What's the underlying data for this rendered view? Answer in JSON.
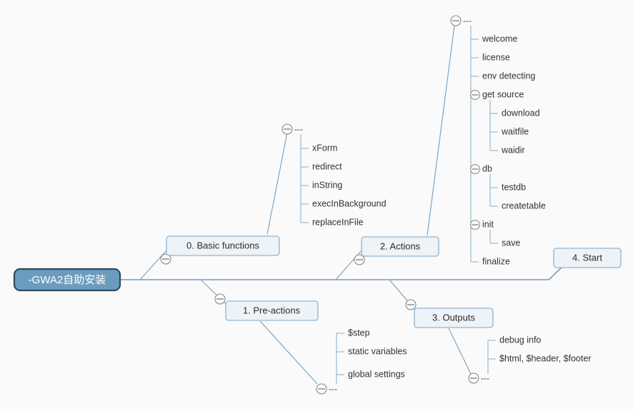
{
  "diagram": {
    "type": "fishbone-mindmap",
    "root": {
      "label": "-GWA2自助安装"
    },
    "ellipsis_label": "---",
    "categories": [
      {
        "id": "basic-functions",
        "label": "0. Basic functions",
        "side": "top",
        "children": [
          {
            "label": "xForm"
          },
          {
            "label": "redirect"
          },
          {
            "label": "inString"
          },
          {
            "label": "execInBackground"
          },
          {
            "label": "replaceInFile"
          }
        ]
      },
      {
        "id": "pre-actions",
        "label": "1. Pre-actions",
        "side": "bottom",
        "children": [
          {
            "label": "$step"
          },
          {
            "label": "static variables"
          },
          {
            "label": "global settings"
          }
        ]
      },
      {
        "id": "actions",
        "label": "2. Actions",
        "side": "top",
        "children": [
          {
            "label": "welcome"
          },
          {
            "label": "license"
          },
          {
            "label": "env detecting"
          },
          {
            "label": "get source",
            "children": [
              {
                "label": "download"
              },
              {
                "label": "waitfile"
              },
              {
                "label": "waidir"
              }
            ]
          },
          {
            "label": "db",
            "children": [
              {
                "label": "testdb"
              },
              {
                "label": "createtable"
              }
            ]
          },
          {
            "label": "init",
            "children": [
              {
                "label": "save"
              }
            ]
          },
          {
            "label": "finalize"
          }
        ]
      },
      {
        "id": "outputs",
        "label": "3. Outputs",
        "side": "bottom",
        "children": [
          {
            "label": "debug info"
          },
          {
            "label": "$html, $header, $footer"
          }
        ]
      },
      {
        "id": "start",
        "label": "4. Start",
        "side": "top",
        "children": []
      }
    ],
    "colors": {
      "background": "#fafafa",
      "spine": "#5b87ad",
      "rib": "#7ba6c9",
      "trunk": "#8fb4cf",
      "box_fill": "#eef3f7",
      "box_stroke": "#7ba6c9",
      "root_fill": "#6c9cbd",
      "root_stroke": "#2d4a5f",
      "root_text": "#ffffff",
      "label_text": "#333333",
      "collapse_stroke": "#8a8a8a"
    }
  }
}
